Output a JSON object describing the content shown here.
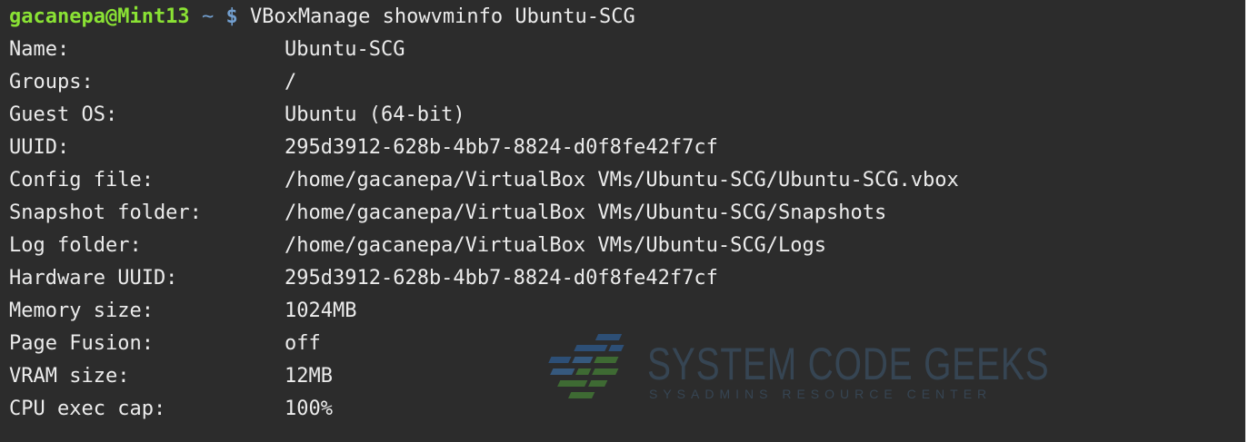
{
  "prompt": {
    "user_host": "gacanepa@Mint13",
    "path": "~",
    "symbol": "$",
    "command": "VBoxManage showvminfo Ubuntu-SCG"
  },
  "info": [
    {
      "key": "Name:",
      "value": "Ubuntu-SCG"
    },
    {
      "key": "Groups:",
      "value": "/"
    },
    {
      "key": "Guest OS:",
      "value": "Ubuntu (64-bit)"
    },
    {
      "key": "UUID:",
      "value": "295d3912-628b-4bb7-8824-d0f8fe42f7cf"
    },
    {
      "key": "Config file:",
      "value": "/home/gacanepa/VirtualBox VMs/Ubuntu-SCG/Ubuntu-SCG.vbox"
    },
    {
      "key": "Snapshot folder:",
      "value": "/home/gacanepa/VirtualBox VMs/Ubuntu-SCG/Snapshots"
    },
    {
      "key": "Log folder:",
      "value": "/home/gacanepa/VirtualBox VMs/Ubuntu-SCG/Logs"
    },
    {
      "key": "Hardware UUID:",
      "value": "295d3912-628b-4bb7-8824-d0f8fe42f7cf"
    },
    {
      "key": "Memory size:",
      "value": "1024MB"
    },
    {
      "key": "Page Fusion:",
      "value": "off"
    },
    {
      "key": "VRAM size:",
      "value": "12MB"
    },
    {
      "key": "CPU exec cap:",
      "value": "100%"
    }
  ],
  "watermark": {
    "title": "SYSTEM CODE GEEKS",
    "subtitle": "SYSADMINS RESOURCE CENTER"
  },
  "colors": {
    "background": "#2c2c2c",
    "text": "#ececec",
    "prompt_user": "#8ae234",
    "prompt_path": "#729fcf"
  }
}
